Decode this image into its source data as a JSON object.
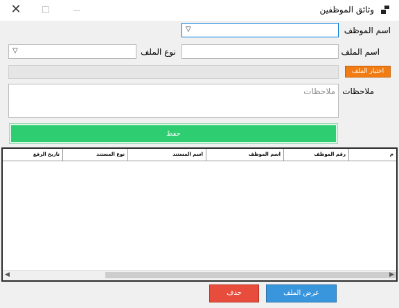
{
  "window": {
    "title": "وثائق الموظفين"
  },
  "form": {
    "employee_label": "اسم الموظف",
    "file_name_label": "اسم الملف",
    "file_type_label": "نوع الملف",
    "choose_file_label": "اختيار الملف",
    "notes_label": "ملاحظات",
    "notes_placeholder": "ملاحظات",
    "save_label": "حفظ"
  },
  "grid": {
    "columns": [
      "م",
      "رقم الموظف",
      "اسم الموظف",
      "اسم المستند",
      "نوع المستند",
      "تاريخ الرفع"
    ],
    "rows": []
  },
  "actions": {
    "view_label": "عرض الملف",
    "delete_label": "حذف"
  },
  "colors": {
    "save": "#2fcd71",
    "choose": "#f17c14",
    "view": "#3a96dc",
    "delete": "#e74c3c"
  }
}
